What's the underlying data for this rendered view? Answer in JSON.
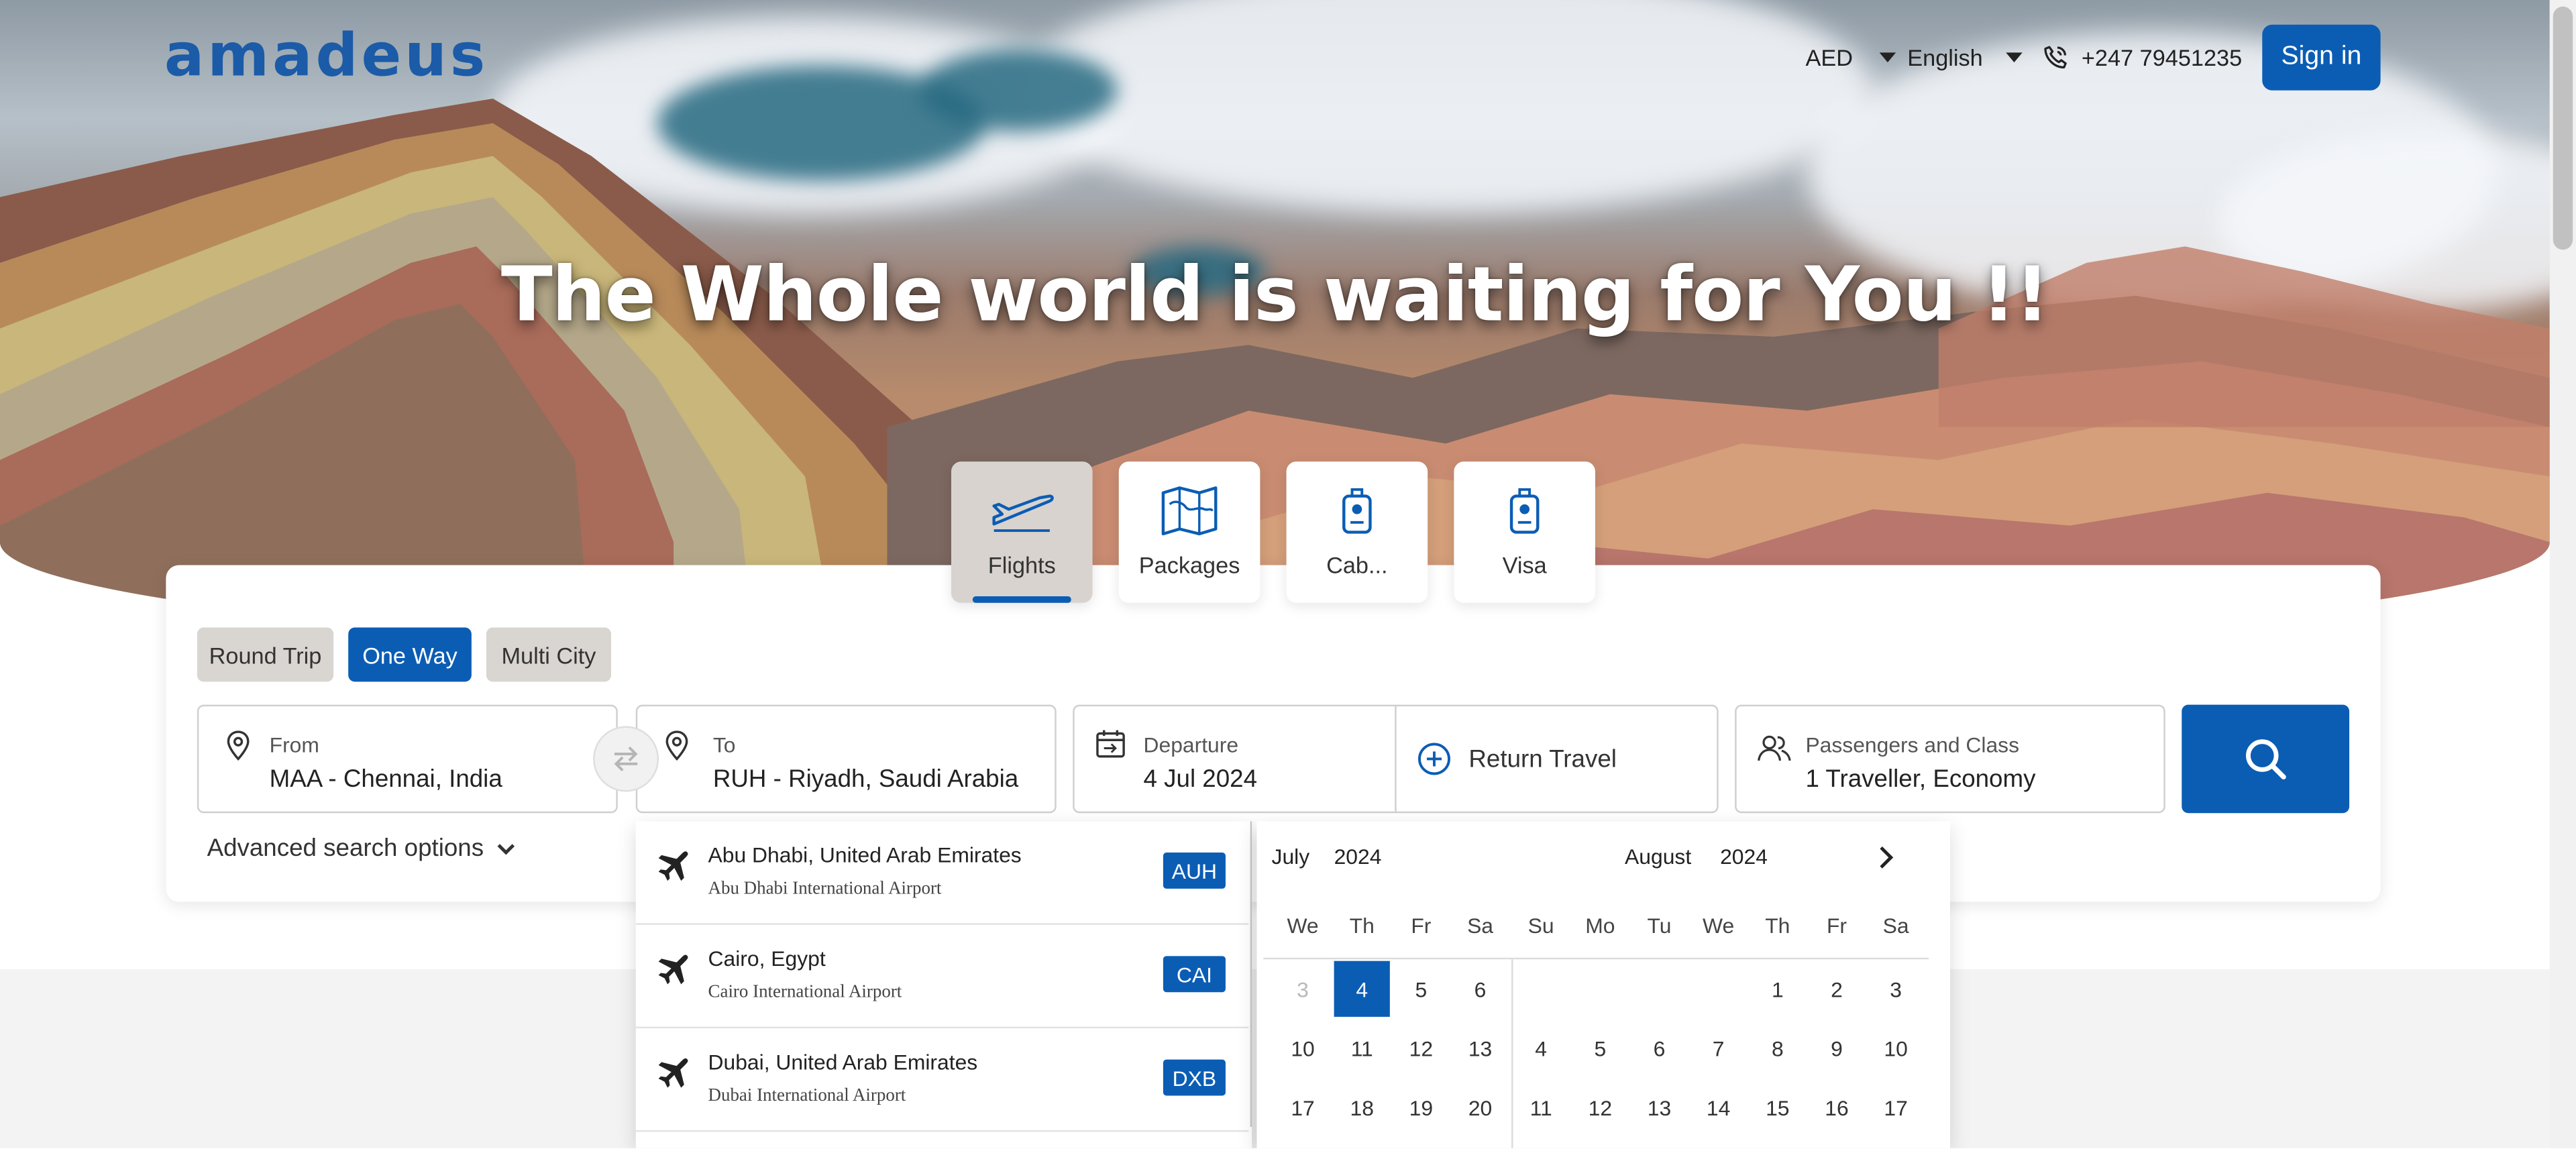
{
  "header": {
    "logo": "amadeus",
    "currency": "AED",
    "language": "English",
    "phone": "+247 79451235",
    "sign_in": "Sign in"
  },
  "hero": {
    "title": "The Whole world is waiting for You !!"
  },
  "services": [
    {
      "label": "Flights",
      "icon": "airplane-icon",
      "active": true
    },
    {
      "label": "Packages",
      "icon": "map-icon",
      "active": false
    },
    {
      "label": "Cab...",
      "icon": "luggage-icon",
      "active": false
    },
    {
      "label": "Visa",
      "icon": "luggage-icon",
      "active": false
    }
  ],
  "trip_types": [
    {
      "label": "Round Trip",
      "active": false
    },
    {
      "label": "One Way",
      "active": true
    },
    {
      "label": "Multi City",
      "active": false
    }
  ],
  "search": {
    "from_label": "From",
    "from_value": "MAA - Chennai, India",
    "to_label": "To",
    "to_value": "RUH - Riyadh, Saudi Arabia",
    "departure_label": "Departure",
    "departure_value": "4 Jul 2024",
    "return_label": "Return Travel",
    "pax_label": "Passengers and Class",
    "pax_value": "1 Traveller, Economy",
    "advanced": "Advanced search options"
  },
  "airport_suggestions": [
    {
      "city": "Abu Dhabi, United Arab Emirates",
      "airport": "Abu Dhabi International Airport",
      "code": "AUH"
    },
    {
      "city": "Cairo, Egypt",
      "airport": "Cairo International Airport",
      "code": "CAI"
    },
    {
      "city": "Dubai, United Arab Emirates",
      "airport": "Dubai International Airport",
      "code": "DXB"
    }
  ],
  "calendar": {
    "left_month": "July",
    "left_year": "2024",
    "right_month": "August",
    "right_year": "2024",
    "left_weekdays": [
      "We",
      "Th",
      "Fr",
      "Sa"
    ],
    "right_weekdays": [
      "Su",
      "Mo",
      "Tu",
      "We",
      "Th",
      "Fr",
      "Sa"
    ],
    "left_rows": [
      [
        "3",
        "4",
        "5",
        "6"
      ],
      [
        "10",
        "11",
        "12",
        "13"
      ],
      [
        "17",
        "18",
        "19",
        "20"
      ]
    ],
    "right_rows": [
      [
        "",
        "",
        "",
        "",
        "1",
        "2",
        "3"
      ],
      [
        "4",
        "5",
        "6",
        "7",
        "8",
        "9",
        "10"
      ],
      [
        "11",
        "12",
        "13",
        "14",
        "15",
        "16",
        "17"
      ]
    ],
    "disabled": [
      "3"
    ],
    "selected": "4"
  },
  "colors": {
    "brand_blue": "#0b5db4",
    "logo_blue": "#1b5ba8",
    "tab_active_bg": "#d8d3cf"
  }
}
